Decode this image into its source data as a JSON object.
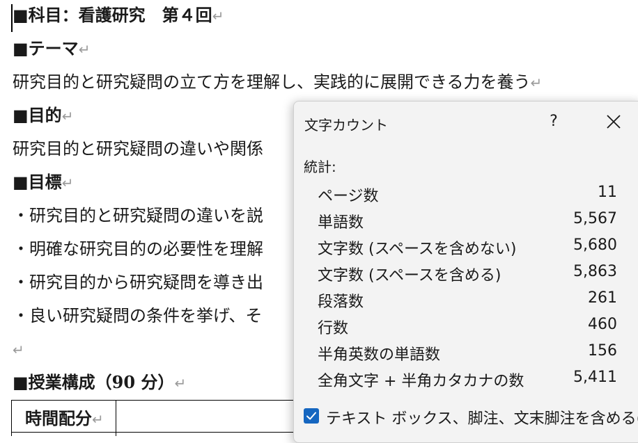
{
  "document": {
    "lines": [
      {
        "text": "■科目：看護研究　第４回",
        "bold": true
      },
      {
        "text": "■テーマ",
        "bold": true
      },
      {
        "text": "研究目的と研究疑問の立て方を理解し、実践的に展開できる力を養う",
        "bold": false
      },
      {
        "text": "■目的",
        "bold": true
      },
      {
        "text": "研究目的と研究疑問の違いや関係",
        "bold": false
      },
      {
        "text": "■目標",
        "bold": true
      },
      {
        "text": "・研究目的と研究疑問の違いを説",
        "bold": false
      },
      {
        "text": "・明確な研究目的の必要性を理解",
        "bold": false
      },
      {
        "text": "・研究目的から研究疑問を導き出",
        "bold": false
      },
      {
        "text": "・良い研究疑問の条件を挙げ、そ",
        "bold": false
      },
      {
        "text": "",
        "bold": false
      },
      {
        "text": "■授業構成（90 分）",
        "bold": true
      }
    ],
    "paragraph_mark": "↵",
    "table_cell": "時間配分"
  },
  "dialog": {
    "title": "文字カウント",
    "help": "?",
    "stats_label": "統計:",
    "rows": [
      {
        "label": "ページ数",
        "value": "11"
      },
      {
        "label": "単語数",
        "value": "5,567"
      },
      {
        "label": "文字数 (スペースを含めない)",
        "value": "5,680"
      },
      {
        "label": "文字数 (スペースを含める)",
        "value": "5,863"
      },
      {
        "label": "段落数",
        "value": "261"
      },
      {
        "label": "行数",
        "value": "460"
      },
      {
        "label": "半角英数の単語数",
        "value": "156"
      },
      {
        "label": "全角文字 + 半角カタカナの数",
        "value": "5,411"
      }
    ],
    "checkbox": {
      "label_before": "テキスト ボックス、脚注、文末脚注を含める(",
      "accesskey": "F",
      "label_after": ")",
      "checked": true
    }
  }
}
